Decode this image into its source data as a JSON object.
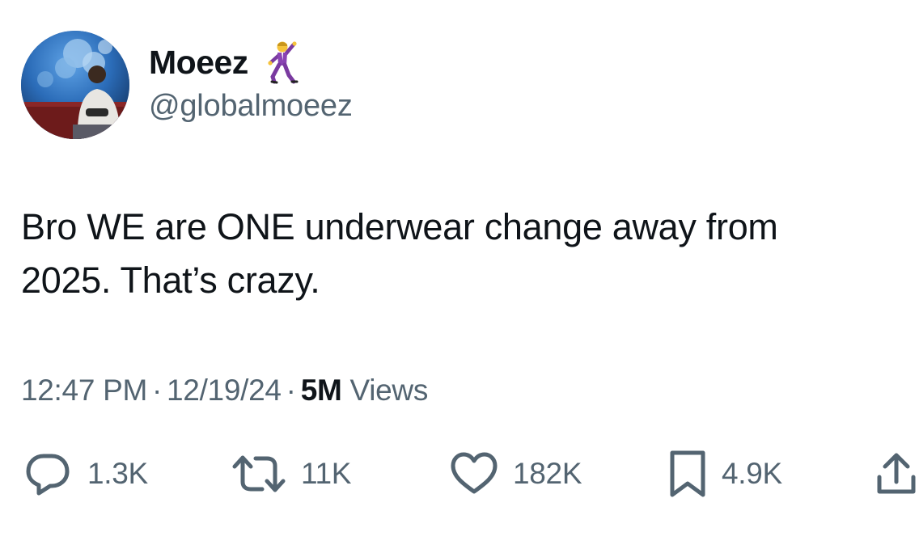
{
  "author": {
    "display_name": "Moeez",
    "handle": "@globalmoeez",
    "name_emoji": "dancing-man-emoji"
  },
  "tweet": {
    "text_line1": "Bro WE are ONE underwear change away from",
    "text_line2": "2025. That’s crazy."
  },
  "meta": {
    "time": "12:47 PM",
    "date": "12/19/24",
    "separator": "·",
    "views_count": "5M",
    "views_label": "Views"
  },
  "actions": {
    "reply": {
      "icon": "reply-icon",
      "count": "1.3K"
    },
    "repost": {
      "icon": "repost-icon",
      "count": "11K"
    },
    "like": {
      "icon": "heart-icon",
      "count": "182K"
    },
    "bookmark": {
      "icon": "bookmark-icon",
      "count": "4.9K"
    },
    "share": {
      "icon": "share-icon"
    }
  },
  "colors": {
    "text_primary": "#0f1419",
    "text_secondary": "#536471",
    "background": "#ffffff"
  }
}
